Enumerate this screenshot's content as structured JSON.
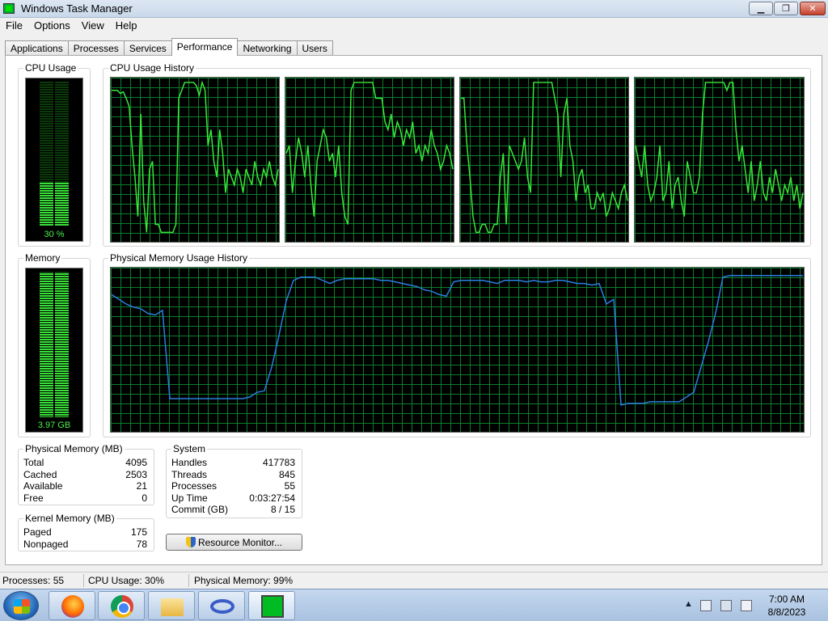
{
  "window": {
    "title": "Windows Task Manager",
    "minimize_label": "▁",
    "maximize_label": "❐",
    "close_label": "✕"
  },
  "menu": [
    "File",
    "Options",
    "View",
    "Help"
  ],
  "tabs": [
    "Applications",
    "Processes",
    "Services",
    "Performance",
    "Networking",
    "Users"
  ],
  "active_tab": "Performance",
  "cpu": {
    "group_label": "CPU Usage",
    "meter_text": "30 %",
    "meter_fraction": 0.3,
    "history_label": "CPU Usage History",
    "cores": [
      [
        95,
        95,
        95,
        93,
        94,
        90,
        85,
        60,
        40,
        15,
        80,
        25,
        5,
        45,
        50,
        10,
        10,
        5,
        5,
        5,
        5,
        5,
        10,
        90,
        95,
        100,
        100,
        100,
        100,
        98,
        92,
        100,
        95,
        60,
        70,
        50,
        40,
        70,
        55,
        30,
        45,
        40,
        35,
        45,
        40,
        30,
        45,
        40,
        35,
        50,
        40,
        35,
        45,
        40,
        50,
        40,
        35,
        45
      ],
      [
        55,
        60,
        30,
        50,
        65,
        55,
        40,
        60,
        35,
        15,
        50,
        60,
        70,
        65,
        50,
        55,
        40,
        60,
        30,
        15,
        10,
        95,
        100,
        100,
        100,
        100,
        100,
        100,
        100,
        90,
        90,
        90,
        75,
        70,
        80,
        65,
        75,
        70,
        60,
        70,
        65,
        75,
        55,
        60,
        50,
        60,
        55,
        70,
        60,
        55,
        45,
        50,
        60,
        55,
        45
      ],
      [
        90,
        90,
        60,
        40,
        15,
        5,
        5,
        10,
        10,
        5,
        5,
        10,
        10,
        40,
        55,
        10,
        60,
        55,
        50,
        45,
        50,
        65,
        40,
        30,
        100,
        100,
        100,
        100,
        100,
        100,
        100,
        90,
        80,
        40,
        80,
        90,
        60,
        50,
        25,
        40,
        45,
        30,
        35,
        20,
        20,
        30,
        25,
        30,
        15,
        20,
        30,
        25,
        20,
        30,
        35,
        25
      ],
      [
        60,
        50,
        40,
        60,
        35,
        25,
        30,
        40,
        60,
        25,
        30,
        50,
        20,
        35,
        40,
        25,
        15,
        50,
        40,
        30,
        30,
        40,
        80,
        100,
        100,
        100,
        100,
        100,
        100,
        100,
        95,
        100,
        100,
        70,
        50,
        60,
        45,
        30,
        50,
        25,
        35,
        50,
        30,
        25,
        40,
        30,
        45,
        35,
        25,
        35,
        30,
        40,
        25,
        35,
        20,
        30
      ]
    ]
  },
  "memory": {
    "group_label": "Memory",
    "meter_text": "3.97 GB",
    "meter_fraction": 0.99,
    "history_label": "Physical Memory Usage History",
    "history": [
      86,
      83,
      80,
      78,
      77,
      74,
      73,
      76,
      20,
      20,
      20,
      20,
      20,
      20,
      20,
      20,
      20,
      20,
      20,
      21,
      24,
      25,
      40,
      60,
      82,
      95,
      97,
      97,
      97,
      95,
      93,
      95,
      96,
      96,
      96,
      96,
      96,
      95,
      95,
      94,
      93,
      92,
      91,
      89,
      88,
      86,
      85,
      94,
      95,
      95,
      95,
      95,
      94,
      93,
      95,
      95,
      95,
      94,
      95,
      94,
      94,
      95,
      95,
      94,
      93,
      93,
      92,
      93,
      80,
      83,
      16,
      17,
      17,
      17,
      18,
      18,
      18,
      18,
      18,
      21,
      24,
      40,
      56,
      74,
      97,
      98,
      98,
      98,
      98,
      98,
      98,
      98,
      98,
      98,
      98,
      98
    ]
  },
  "physical_memory": {
    "label": "Physical Memory (MB)",
    "rows": [
      {
        "k": "Total",
        "v": "4095"
      },
      {
        "k": "Cached",
        "v": "2503"
      },
      {
        "k": "Available",
        "v": "21"
      },
      {
        "k": "Free",
        "v": "0"
      }
    ]
  },
  "kernel_memory": {
    "label": "Kernel Memory (MB)",
    "rows": [
      {
        "k": "Paged",
        "v": "175"
      },
      {
        "k": "Nonpaged",
        "v": "78"
      }
    ]
  },
  "system": {
    "label": "System",
    "rows": [
      {
        "k": "Handles",
        "v": "417783"
      },
      {
        "k": "Threads",
        "v": "845"
      },
      {
        "k": "Processes",
        "v": "55"
      },
      {
        "k": "Up Time",
        "v": "0:03:27:54"
      },
      {
        "k": "Commit (GB)",
        "v": "8 / 15"
      }
    ]
  },
  "resource_monitor_label": "Resource Monitor...",
  "statusbar": {
    "processes": "Processes: 55",
    "cpu": "CPU Usage: 30%",
    "memory": "Physical Memory: 99%"
  },
  "taskbar": {
    "apps": [
      "firefox-icon",
      "chrome-icon",
      "file-explorer-icon",
      "visual-studio-icon",
      "task-manager-icon"
    ],
    "tray_arrow": "▲",
    "time": "7:00 AM",
    "date": "8/8/2023"
  },
  "colors": {
    "cpu_line": "#39e83a",
    "memory_line": "#2a7fe0",
    "grid": "#0b7f2c"
  }
}
